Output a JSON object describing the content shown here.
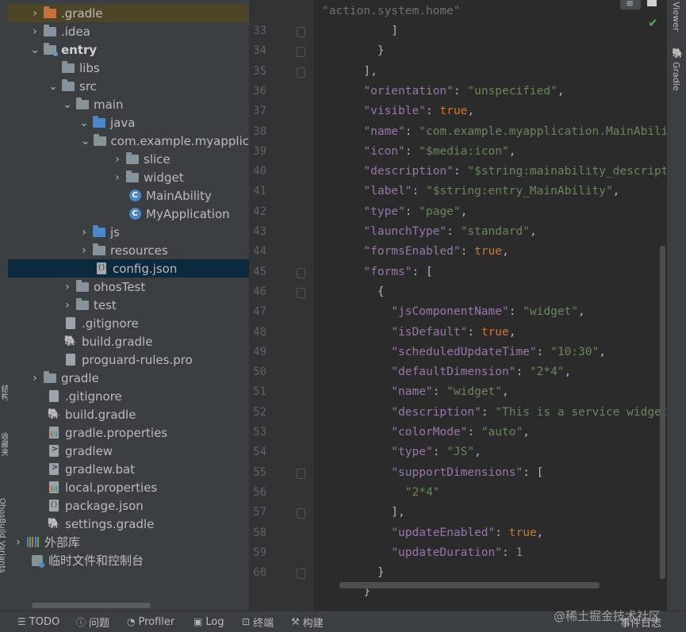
{
  "side_tabs": {
    "left": [
      "结构",
      "收藏夹",
      "OhosBuild Variants"
    ],
    "right": [
      "Viewer",
      "Gradle"
    ]
  },
  "project_tree": [
    {
      "label": ".gradle",
      "icon": "folder-orange-icon",
      "chevron": "right"
    },
    {
      "label": ".idea",
      "icon": "folder-icon",
      "chevron": "right"
    },
    {
      "label": "entry",
      "icon": "module-folder-icon",
      "chevron": "down"
    },
    {
      "label": "libs",
      "icon": "folder-icon",
      "chevron": ""
    },
    {
      "label": "src",
      "icon": "folder-icon",
      "chevron": "down"
    },
    {
      "label": "main",
      "icon": "folder-icon",
      "chevron": "down"
    },
    {
      "label": "java",
      "icon": "source-folder-icon",
      "chevron": "down"
    },
    {
      "label": "com.example.myapplic",
      "icon": "package-icon",
      "chevron": "down"
    },
    {
      "label": "slice",
      "icon": "package-icon",
      "chevron": "right"
    },
    {
      "label": "widget",
      "icon": "package-icon",
      "chevron": "right"
    },
    {
      "label": "MainAbility",
      "icon": "class-icon",
      "chevron": ""
    },
    {
      "label": "MyApplication",
      "icon": "class-icon",
      "chevron": ""
    },
    {
      "label": "js",
      "icon": "source-folder-icon",
      "chevron": "right"
    },
    {
      "label": "resources",
      "icon": "resources-folder-icon",
      "chevron": "right"
    },
    {
      "label": "config.json",
      "icon": "json-file-icon",
      "chevron": ""
    },
    {
      "label": "ohosTest",
      "icon": "folder-icon",
      "chevron": "right"
    },
    {
      "label": "test",
      "icon": "folder-icon",
      "chevron": "right"
    },
    {
      "label": ".gitignore",
      "icon": "gitignore-file-icon",
      "chevron": ""
    },
    {
      "label": "build.gradle",
      "icon": "gradle-elephant-icon",
      "chevron": ""
    },
    {
      "label": "proguard-rules.pro",
      "icon": "text-file-icon",
      "chevron": ""
    },
    {
      "label": "gradle",
      "icon": "folder-icon",
      "chevron": "right"
    },
    {
      "label": ".gitignore",
      "icon": "gitignore-file-icon",
      "chevron": ""
    },
    {
      "label": "build.gradle",
      "icon": "gradle-elephant-icon",
      "chevron": ""
    },
    {
      "label": "gradle.properties",
      "icon": "properties-file-icon",
      "chevron": ""
    },
    {
      "label": "gradlew",
      "icon": "terminal-file-icon",
      "chevron": ""
    },
    {
      "label": "gradlew.bat",
      "icon": "terminal-file-icon",
      "chevron": ""
    },
    {
      "label": "local.properties",
      "icon": "properties-file-icon",
      "chevron": ""
    },
    {
      "label": "package.json",
      "icon": "json-file-icon",
      "chevron": ""
    },
    {
      "label": "settings.gradle",
      "icon": "gradle-elephant-icon",
      "chevron": ""
    },
    {
      "label": "外部库",
      "icon": "libraries-icon",
      "chevron": "right"
    },
    {
      "label": "临时文件和控制台",
      "icon": "scratches-icon",
      "chevron": ""
    }
  ],
  "editor": {
    "partial_top_line": "\"action.system.home\"",
    "line_numbers": [
      "33",
      "34",
      "35",
      "36",
      "37",
      "38",
      "39",
      "40",
      "41",
      "42",
      "43",
      "44",
      "45",
      "46",
      "47",
      "48",
      "49",
      "50",
      "51",
      "52",
      "53",
      "54",
      "55",
      "56",
      "57",
      "58",
      "59",
      "60"
    ],
    "lines": [
      "          ]",
      "        }",
      "      ],",
      "      \"orientation\": \"unspecified\",",
      "      \"visible\": true,",
      "      \"name\": \"com.example.myapplication.MainAbility\"",
      "      \"icon\": \"$media:icon\",",
      "      \"description\": \"$string:mainability_description\"",
      "      \"label\": \"$string:entry_MainAbility\",",
      "      \"type\": \"page\",",
      "      \"launchType\": \"standard\",",
      "      \"formsEnabled\": true,",
      "      \"forms\": [",
      "        {",
      "          \"jsComponentName\": \"widget\",",
      "          \"isDefault\": true,",
      "          \"scheduledUpdateTime\": \"10:30\",",
      "          \"defaultDimension\": \"2*4\",",
      "          \"name\": \"widget\",",
      "          \"description\": \"This is a service widget\",",
      "          \"colorMode\": \"auto\",",
      "          \"type\": \"JS\",",
      "          \"supportDimensions\": [",
      "            \"2*4\"",
      "          ],",
      "          \"updateEnabled\": true,",
      "          \"updateDuration\": 1",
      "        }"
    ],
    "partial_bottom_line": "      }"
  },
  "bottom_bar": {
    "tabs": [
      {
        "label": "TODO",
        "icon": "list-icon"
      },
      {
        "label": "问题",
        "icon": "problems-icon"
      },
      {
        "label": "Profiler",
        "icon": "profiler-icon"
      },
      {
        "label": "Log",
        "icon": "log-icon"
      },
      {
        "label": "终端",
        "icon": "terminal-icon"
      },
      {
        "label": "构建",
        "icon": "hammer-icon"
      }
    ],
    "event_log": "事件日志"
  },
  "watermark": "@稀土掘金技术社区",
  "colors": {
    "key": "#9876aa",
    "string": "#6a8759",
    "keyword": "#cc7832",
    "number": "#6897bb",
    "selection": "#0d293e",
    "panel": "#3c3f41",
    "editor_bg": "#2b2b2b"
  }
}
